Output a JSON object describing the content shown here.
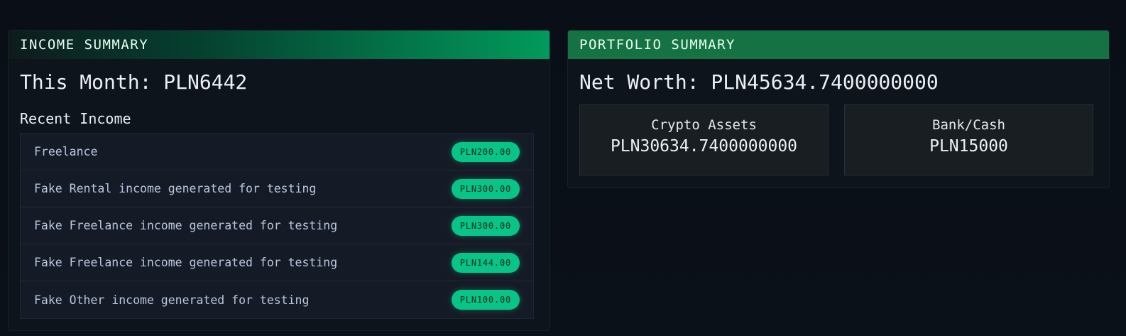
{
  "income_summary": {
    "header": "INCOME SUMMARY",
    "this_month": "This Month: PLN6442",
    "recent_heading": "Recent Income",
    "items": [
      {
        "label": "Freelance",
        "amount": "PLN200.00"
      },
      {
        "label": "Fake Rental income generated for testing",
        "amount": "PLN300.00"
      },
      {
        "label": "Fake Freelance income generated for testing",
        "amount": "PLN300.00"
      },
      {
        "label": "Fake Freelance income generated for testing",
        "amount": "PLN144.00"
      },
      {
        "label": "Fake Other income generated for testing",
        "amount": "PLN100.00"
      }
    ]
  },
  "portfolio_summary": {
    "header": "PORTFOLIO SUMMARY",
    "net_worth": "Net Worth: PLN45634.7400000000",
    "crypto": {
      "label": "Crypto Assets",
      "value": "PLN30634.7400000000"
    },
    "bank": {
      "label": "Bank/Cash",
      "value": "PLN15000"
    }
  },
  "colors": {
    "accent_green": "#08c487",
    "header_green": "#157243",
    "background": "#0a0f17"
  }
}
